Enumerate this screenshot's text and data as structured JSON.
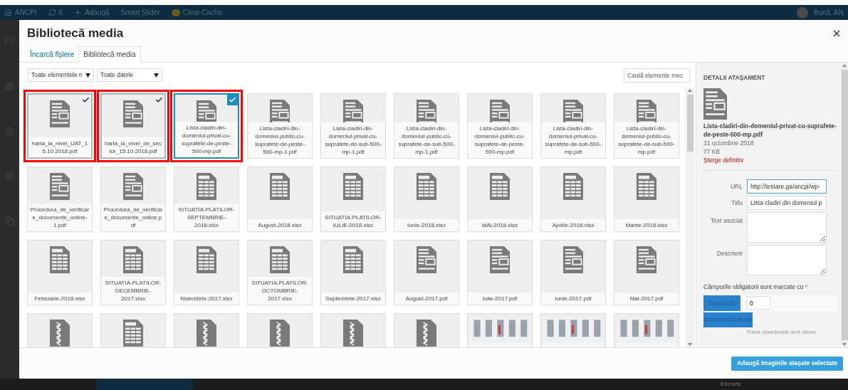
{
  "admin_bar": {
    "items": [
      {
        "kind": "home",
        "label": "ANCPI"
      },
      {
        "kind": "updates",
        "label": "6"
      },
      {
        "kind": "add",
        "label": "Adaugă"
      },
      {
        "kind": "text",
        "label": "Smart Slider"
      },
      {
        "kind": "cache",
        "label": "Clear Cache"
      }
    ],
    "greeting": "Bună, AN"
  },
  "modal": {
    "title": "Bibliotecă media",
    "tabs": [
      {
        "label": "Încarcă fișiere",
        "selected": false
      },
      {
        "label": "Bibliotecă media",
        "selected": true
      }
    ],
    "filters": [
      {
        "value": "Toate elementele n"
      },
      {
        "value": "Toate datele"
      }
    ],
    "search": {
      "placeholder": "Caută elemente mec"
    },
    "items": [
      {
        "kind": "document",
        "label": "harta_la_nivel_UAT_15.10.2018.pdf",
        "selected": true,
        "current": false,
        "annotated": true
      },
      {
        "kind": "document",
        "label": "harta_la_nivel_de_sector_15.10.2018.pdf",
        "selected": true,
        "current": false,
        "annotated": true
      },
      {
        "kind": "document",
        "label": "Lista-cladiri-din-domeniul-privat-cu-suprafete-de-peste-500-mp.pdf",
        "selected": true,
        "current": true,
        "annotated": true
      },
      {
        "kind": "document",
        "label": "Lista-cladiri-din-domeniul-public-cu-suprafete-de-peste-500-mp-1.pdf",
        "selected": false,
        "current": false,
        "annotated": false
      },
      {
        "kind": "document",
        "label": "Lista-cladiri-din-domeniul-privat-cu-suprafete-de-sub-500-mp-1.pdf",
        "selected": false,
        "current": false,
        "annotated": false
      },
      {
        "kind": "document",
        "label": "Lista-cladiri-din-domeniul-public-cu-suprafete-de-sub-500-mp-1.pdf",
        "selected": false,
        "current": false,
        "annotated": false
      },
      {
        "kind": "document",
        "label": "Lista-cladiri-din-domeniul-public-cu-suprafete-de-peste-500-mp.pdf",
        "selected": false,
        "current": false,
        "annotated": false
      },
      {
        "kind": "document",
        "label": "Lista-cladiri-din-domeniul-privat-cu-suprafete-de-sub-500-mp.pdf",
        "selected": false,
        "current": false,
        "annotated": false
      },
      {
        "kind": "document",
        "label": "Lista-cladiri-din-domeniul-public-cu-suprafete-de-sub-500-mp.pdf",
        "selected": false,
        "current": false,
        "annotated": false
      },
      {
        "kind": "document",
        "label": "Procedura_de_verificare_documente_online-1.pdf",
        "selected": false,
        "current": false,
        "annotated": false
      },
      {
        "kind": "document",
        "label": "Procedura_de_verificare_documente_online.pdf",
        "selected": false,
        "current": false,
        "annotated": false
      },
      {
        "kind": "spreadsheet",
        "label": "SITUATIA-PLATILOR-SEPTEMBRIE-2018.xlsx",
        "selected": false,
        "current": false,
        "annotated": false
      },
      {
        "kind": "spreadsheet",
        "label": "August-2018.xlsx",
        "selected": false,
        "current": false,
        "annotated": false
      },
      {
        "kind": "spreadsheet",
        "label": "SITUATIA-PLATILOR-IULIE-2018.xlsx",
        "selected": false,
        "current": false,
        "annotated": false
      },
      {
        "kind": "spreadsheet",
        "label": "Iunie-2018.xlsx",
        "selected": false,
        "current": false,
        "annotated": false
      },
      {
        "kind": "spreadsheet",
        "label": "MAi-2018.xlsx",
        "selected": false,
        "current": false,
        "annotated": false
      },
      {
        "kind": "spreadsheet",
        "label": "Aprilie-2018.xlsx",
        "selected": false,
        "current": false,
        "annotated": false
      },
      {
        "kind": "spreadsheet",
        "label": "Martie-2018.xlsx",
        "selected": false,
        "current": false,
        "annotated": false
      },
      {
        "kind": "spreadsheet",
        "label": "Februarie-2018.xlsx",
        "selected": false,
        "current": false,
        "annotated": false
      },
      {
        "kind": "spreadsheet",
        "label": "SITUATIA-PLATILOR-DECEMBRIE-2017.xlsx",
        "selected": false,
        "current": false,
        "annotated": false
      },
      {
        "kind": "spreadsheet",
        "label": "Noiembrie-2017.xlsx",
        "selected": false,
        "current": false,
        "annotated": false
      },
      {
        "kind": "spreadsheet",
        "label": "SITUATIA-PLATILOR-OCTOMBRIE-2017.xlsx",
        "selected": false,
        "current": false,
        "annotated": false
      },
      {
        "kind": "spreadsheet",
        "label": "Septembrie-2017.xlsx",
        "selected": false,
        "current": false,
        "annotated": false
      },
      {
        "kind": "document",
        "label": "August-2017.pdf",
        "selected": false,
        "current": false,
        "annotated": false
      },
      {
        "kind": "document",
        "label": "Iulie-2017.pdf",
        "selected": false,
        "current": false,
        "annotated": false
      },
      {
        "kind": "document",
        "label": "Iunie-2017.pdf",
        "selected": false,
        "current": false,
        "annotated": false
      },
      {
        "kind": "document",
        "label": "Mai-2017.pdf",
        "selected": false,
        "current": false,
        "annotated": false
      },
      {
        "kind": "archive",
        "selected": false,
        "current": false,
        "annotated": false
      },
      {
        "kind": "spreadsheet",
        "selected": false,
        "current": false,
        "annotated": false
      },
      {
        "kind": "archive",
        "selected": false,
        "current": false,
        "annotated": false
      },
      {
        "kind": "archive",
        "selected": false,
        "current": false,
        "annotated": false
      },
      {
        "kind": "archive",
        "selected": false,
        "current": false,
        "annotated": false
      },
      {
        "kind": "archive",
        "selected": false,
        "current": false,
        "annotated": false
      },
      {
        "kind": "picture",
        "selected": false,
        "current": false,
        "annotated": false
      },
      {
        "kind": "picture",
        "selected": false,
        "current": false,
        "annotated": false
      },
      {
        "kind": "picture",
        "selected": false,
        "current": false,
        "annotated": false
      }
    ],
    "details": {
      "heading": "DETALII ATAȘAMENT",
      "filename": "Lista-cladiri-din-domeniul-privat-cu-suprafete-de-peste-500-mp.pdf",
      "date": "31 octombrie 2018",
      "size": "77 KB",
      "delete_link": "Șterge definitiv",
      "fields": [
        {
          "kind": "input",
          "label": "URL",
          "value": "http://testare.ga/ancpi/wp-"
        },
        {
          "kind": "input",
          "label": "Titlu",
          "value": "Lista cladiri din domeniul p"
        },
        {
          "kind": "textarea",
          "label": "Text asociat"
        },
        {
          "kind": "textarea",
          "label": "Descriere"
        }
      ],
      "required_note": "Câmpurile obligatorii sunt marcate cu",
      "required_mark": "*",
      "downloads_label": "Descărcări",
      "downloads_value": "0",
      "views_button": "Downloads/Views",
      "track_note": "Track downloads and views"
    },
    "insert_button": "Adaugă imaginile atașate selectate"
  },
  "background_label": "Etichete"
}
